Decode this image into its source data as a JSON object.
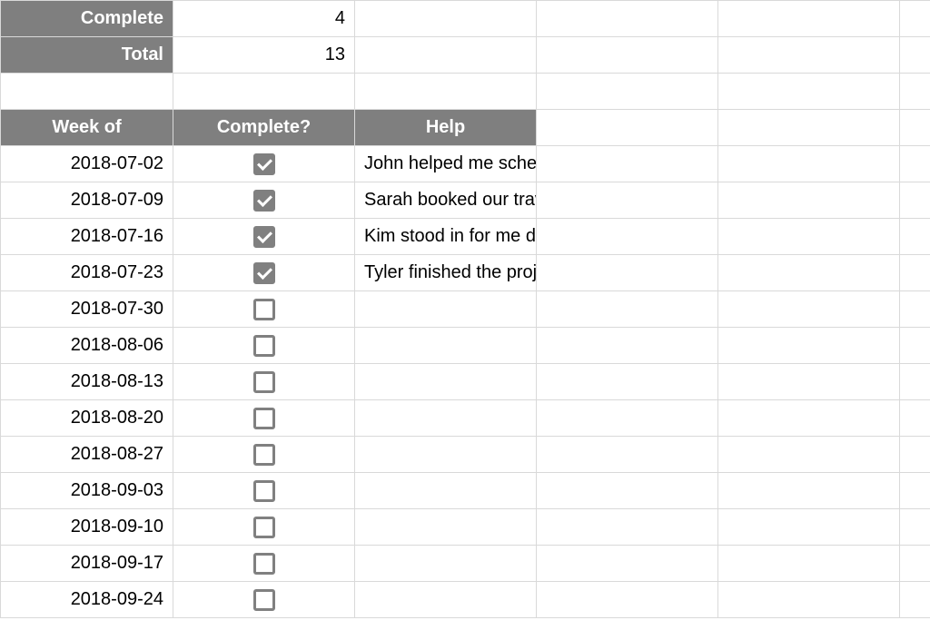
{
  "summary": {
    "complete_label": "Complete",
    "complete_value": "4",
    "total_label": "Total",
    "total_value": "13"
  },
  "headers": {
    "week_of": "Week of",
    "complete": "Complete?",
    "help": "Help"
  },
  "rows": [
    {
      "date": "2018-07-02",
      "checked": true,
      "help": "John helped me schedule usability tests."
    },
    {
      "date": "2018-07-09",
      "checked": true,
      "help": "Sarah booked our travel for next month."
    },
    {
      "date": "2018-07-16",
      "checked": true,
      "help": "Kim stood in for me during sprint ceremonies this week."
    },
    {
      "date": "2018-07-23",
      "checked": true,
      "help": "Tyler finished the project estimation sheet."
    },
    {
      "date": "2018-07-30",
      "checked": false,
      "help": ""
    },
    {
      "date": "2018-08-06",
      "checked": false,
      "help": ""
    },
    {
      "date": "2018-08-13",
      "checked": false,
      "help": ""
    },
    {
      "date": "2018-08-20",
      "checked": false,
      "help": ""
    },
    {
      "date": "2018-08-27",
      "checked": false,
      "help": ""
    },
    {
      "date": "2018-09-03",
      "checked": false,
      "help": ""
    },
    {
      "date": "2018-09-10",
      "checked": false,
      "help": ""
    },
    {
      "date": "2018-09-17",
      "checked": false,
      "help": ""
    },
    {
      "date": "2018-09-24",
      "checked": false,
      "help": ""
    }
  ]
}
